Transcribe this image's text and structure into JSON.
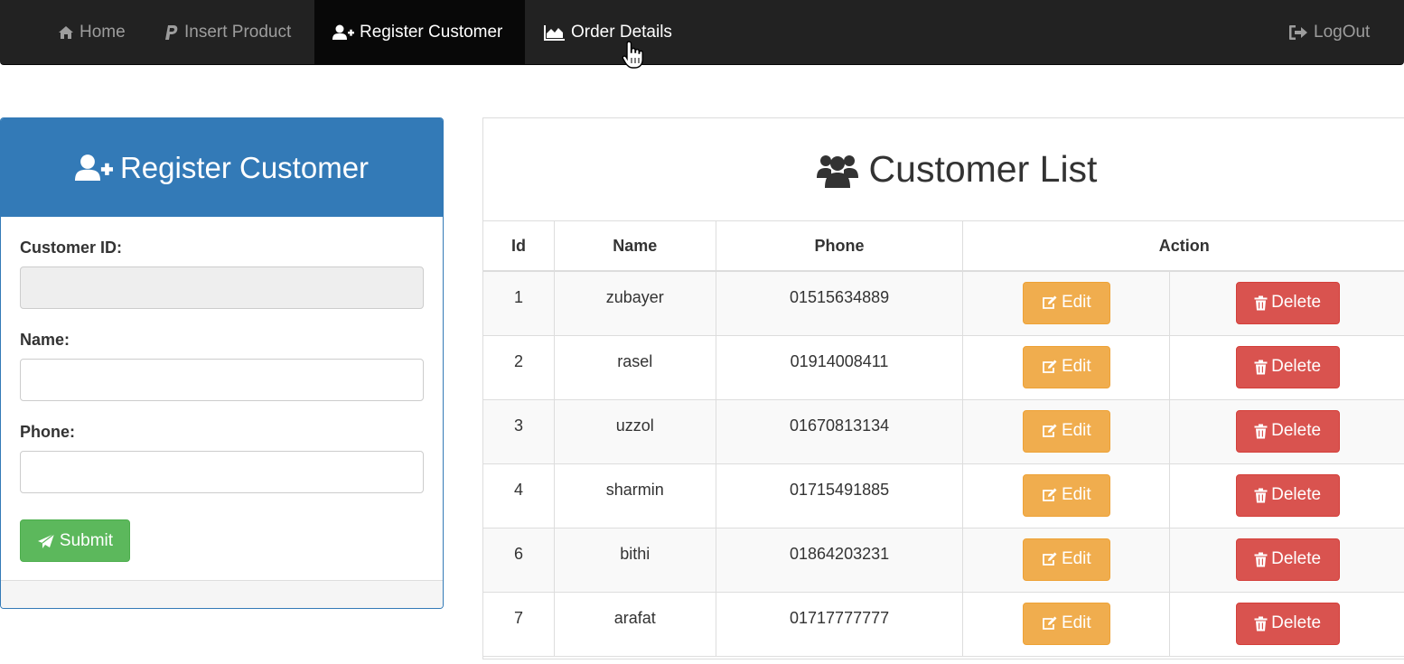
{
  "nav": {
    "home": "Home",
    "insert_product": "Insert Product",
    "register_customer": "Register Customer",
    "order_details": "Order Details",
    "logout": "LogOut"
  },
  "register_panel": {
    "title": "Register Customer",
    "customer_id_label": "Customer ID:",
    "customer_id_value": "",
    "name_label": "Name:",
    "name_value": "",
    "phone_label": "Phone:",
    "phone_value": "",
    "submit_label": "Submit"
  },
  "customer_list": {
    "title": "Customer List",
    "headers": {
      "id": "Id",
      "name": "Name",
      "phone": "Phone",
      "action": "Action"
    },
    "edit_label": "Edit",
    "delete_label": "Delete",
    "rows": [
      {
        "id": "1",
        "name": "zubayer",
        "phone": "01515634889"
      },
      {
        "id": "2",
        "name": "rasel",
        "phone": "01914008411"
      },
      {
        "id": "3",
        "name": "uzzol",
        "phone": "01670813134"
      },
      {
        "id": "4",
        "name": "sharmin",
        "phone": "01715491885"
      },
      {
        "id": "6",
        "name": "bithi",
        "phone": "01864203231"
      },
      {
        "id": "7",
        "name": "arafat",
        "phone": "01717777777"
      }
    ]
  },
  "colors": {
    "navbar": "#222222",
    "primary": "#337ab7",
    "success": "#5cb85c",
    "warning": "#f0ad4e",
    "danger": "#d9534f"
  }
}
